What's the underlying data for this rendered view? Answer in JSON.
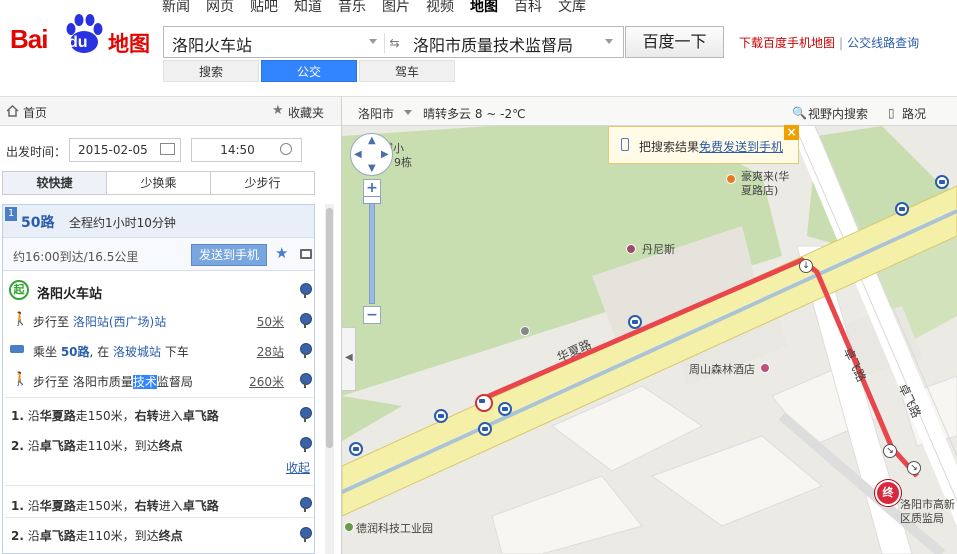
{
  "logo": {
    "bai": "Bai",
    "du": "du",
    "map": "地图"
  },
  "topnav": [
    "新闻",
    "网页",
    "贴吧",
    "知道",
    "音乐",
    "图片",
    "视频",
    "地图",
    "百科",
    "文库"
  ],
  "topnav_active": "地图",
  "search": {
    "origin": "洛阳火车站",
    "destination": "洛阳市质量技术监督局",
    "button": "百度一下"
  },
  "toplinks": {
    "download": "下载百度手机地图",
    "sep": "|",
    "bus_query": "公交线路查询"
  },
  "modes": [
    "搜索",
    "公交",
    "驾车"
  ],
  "mode_active": "公交",
  "panel": {
    "home": "首页",
    "favorite": "收藏夹",
    "depart_label": "出发时间：",
    "date": "2015-02-05",
    "time": "14:50",
    "prefs": [
      "较快捷",
      "少换乘",
      "少步行"
    ],
    "pref_active": "较快捷",
    "plan": {
      "index": "1",
      "route": "50路",
      "total": "全程约1小时10分钟",
      "eta": "约16:00到达/16.5公里",
      "send_button": "发送到手机",
      "start_badge": "起",
      "start_name": "洛阳火车站",
      "steps": [
        {
          "pre": "步行至 ",
          "link": "洛阳站(西广场)站",
          "post": "",
          "dist": "50米"
        },
        {
          "pre": "乘坐 ",
          "link": "50路",
          "mid": ", 在 ",
          "link2": "洛玻城站",
          "post": " 下车",
          "dist": "28站"
        },
        {
          "pre": "步行至 洛阳市质量",
          "sel": "技术",
          "post": "监督局",
          "dist": "260米"
        }
      ],
      "walk_steps": [
        {
          "n": "1.",
          "a": " 沿",
          "road1": "华夏路",
          "b": "走150米，",
          "turn": "右转",
          "c": "进入",
          "road2": "卓飞路"
        },
        {
          "n": "2.",
          "a": " 沿",
          "road1": "卓飞路",
          "b": "走110米，到达",
          "end": "终点"
        }
      ],
      "collapse": "收起",
      "walk_steps_2": [
        {
          "n": "1.",
          "a": " 沿",
          "road1": "华夏路",
          "b": "走150米，",
          "turn": "右转",
          "c": "进入",
          "road2": "卓飞路"
        },
        {
          "n": "2.",
          "a": " 沿",
          "road1": "卓飞路",
          "b": "走110米，到达",
          "end": "终点"
        }
      ]
    }
  },
  "maptoolbar": {
    "city": "洛阳市",
    "weather": "晴转多云 8 ~ -2℃",
    "view_search": "视野内搜索",
    "traffic": "路况"
  },
  "notice": {
    "text": "把搜索结果",
    "link": "免费发送到手机",
    "close": "×"
  },
  "map": {
    "labels": {
      "city_small": "城小",
      "building": "9栋",
      "haoshuanglai": "豪爽来(华",
      "haoshuanglai2": "夏路店)",
      "dennis": "丹尼斯",
      "huaxia_road": "华夏路",
      "zhoushan_hotel": "周山森林酒店",
      "zhuofei_road1": "卓飞路",
      "zhuofei_road2": "卓飞路",
      "end_label1": "洛阳市高新",
      "end_label2": "区质监局",
      "industrial_park": "德润科技工业园",
      "end_marker": "终"
    },
    "colors": {
      "route": "#e8464b",
      "road_fill": "#f5f0a8",
      "road_border": "#d8c86a",
      "green": "#c8ddb0",
      "block": "#f7f6f2"
    }
  }
}
